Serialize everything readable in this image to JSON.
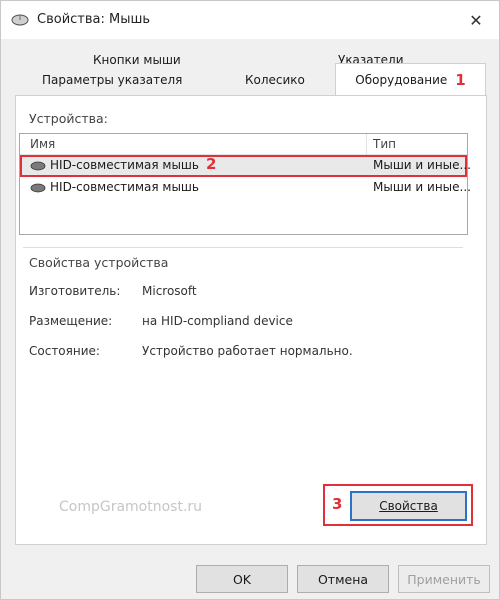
{
  "window": {
    "title": "Свойства: Мышь",
    "close_glyph": "✕"
  },
  "tabs": {
    "row1": [
      "Кнопки мыши",
      "Указатели"
    ],
    "row2": [
      "Параметры указателя",
      "Колесико"
    ],
    "active": "Оборудование",
    "active_annotation": "1"
  },
  "devices": {
    "label": "Устройства:",
    "columns": [
      "Имя",
      "Тип"
    ],
    "rows": [
      {
        "name": "HID-совместимая мышь",
        "type": "Мыши и иные...",
        "annotation": "2"
      },
      {
        "name": "HID-совместимая мышь",
        "type": "Мыши и иные..."
      }
    ]
  },
  "device_properties": {
    "label": "Свойства устройства",
    "fields": [
      {
        "label": "Изготовитель:",
        "value": "Microsoft"
      },
      {
        "label": "Размещение:",
        "value": "на HID-compliand device"
      },
      {
        "label": "Состояние:",
        "value": "Устройство работает нормально."
      }
    ]
  },
  "watermark": "CompGramotnost.ru",
  "properties_button": {
    "label": "Свойства",
    "annotation": "3"
  },
  "buttons": {
    "ok": "OK",
    "cancel": "Отмена",
    "apply": "Применить"
  },
  "colors": {
    "annotation": "#e0303a",
    "focus": "#2b73c6"
  },
  "icons": {
    "title": "mouse-icon",
    "row": "mouse-icon",
    "close": "close-icon"
  }
}
